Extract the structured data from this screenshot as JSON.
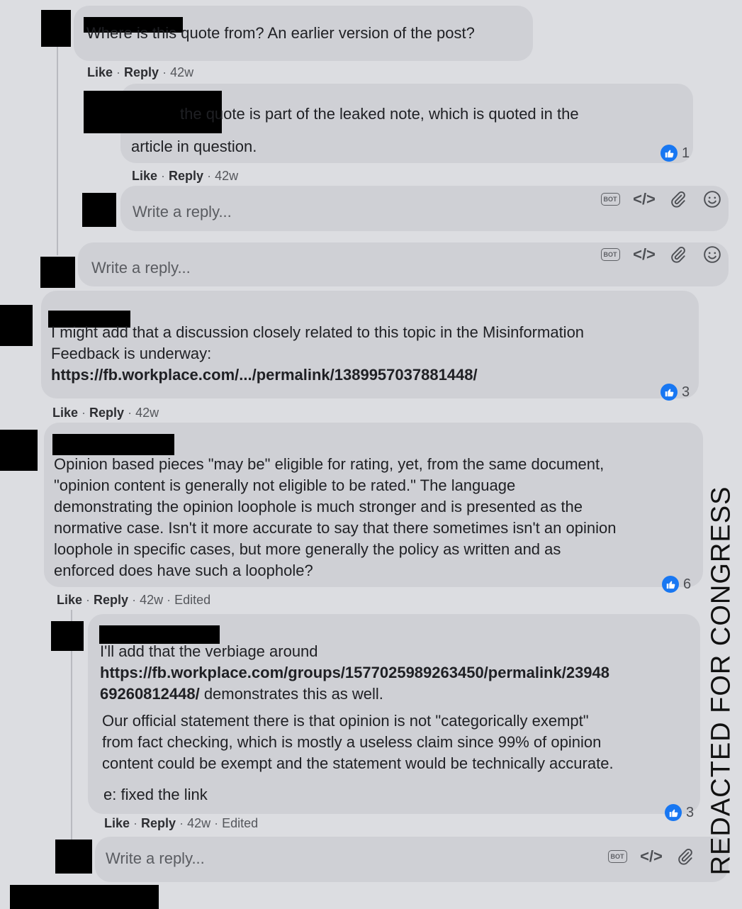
{
  "comments": {
    "c1": {
      "text": "Where is this quote from? An earlier version of the post?",
      "like": "Like",
      "reply": "Reply",
      "time": "42w"
    },
    "c2": {
      "text_line1": "the quote is part of the leaked note, which is quoted in the",
      "text_line2": "article in question.",
      "like": "Like",
      "reply": "Reply",
      "time": "42w",
      "reactions": "1"
    },
    "c3": {
      "line1": "I might add that a discussion closely related to this topic in the Misinformation",
      "line2": "Feedback is underway:",
      "link": "https://fb.workplace.com/.../permalink/1389957037881448/",
      "like": "Like",
      "reply": "Reply",
      "time": "42w",
      "reactions": "3"
    },
    "c4": {
      "lines": [
        "Opinion based pieces \"may be\" eligible for rating, yet, from the same document,",
        "\"opinion content is generally not eligible to be rated.\" The language",
        "demonstrating the opinion loophole is much stronger and is presented as the",
        "normative case. Isn't it more accurate to say that there sometimes isn't an opinion",
        "loophole in specific cases, but more generally the policy as written and as",
        "enforced does have such a loophole?"
      ],
      "like": "Like",
      "reply": "Reply",
      "time": "42w",
      "edited": "Edited",
      "reactions": "6"
    },
    "c5": {
      "line1": "I'll add that the verbiage around",
      "link_line1": "https://fb.workplace.com/groups/1577025989263450/permalink/23948",
      "link_line2": "69260812448/",
      "line2_rest": " demonstrates this as well.",
      "para2": [
        "Our official statement there is that opinion is not \"categorically exempt\"",
        "from fact checking, which is mostly a useless claim since 99% of opinion",
        "content could be exempt and the statement would be technically accurate."
      ],
      "para3": "e: fixed the link",
      "like": "Like",
      "reply": "Reply",
      "time": "42w",
      "edited": "Edited",
      "reactions": "3"
    }
  },
  "reply_placeholder": "Write a reply...",
  "tool_icons": [
    "bot-icon",
    "code-icon",
    "paperclip-icon",
    "emoji-icon"
  ],
  "bot_label": "BOT",
  "code_glyph": "</>",
  "stamp": "REDACTED FOR CONGRESS",
  "colors": {
    "like_blue": "#1877f2",
    "bubble": "#cfd0d5",
    "background": "#dcdde1"
  }
}
